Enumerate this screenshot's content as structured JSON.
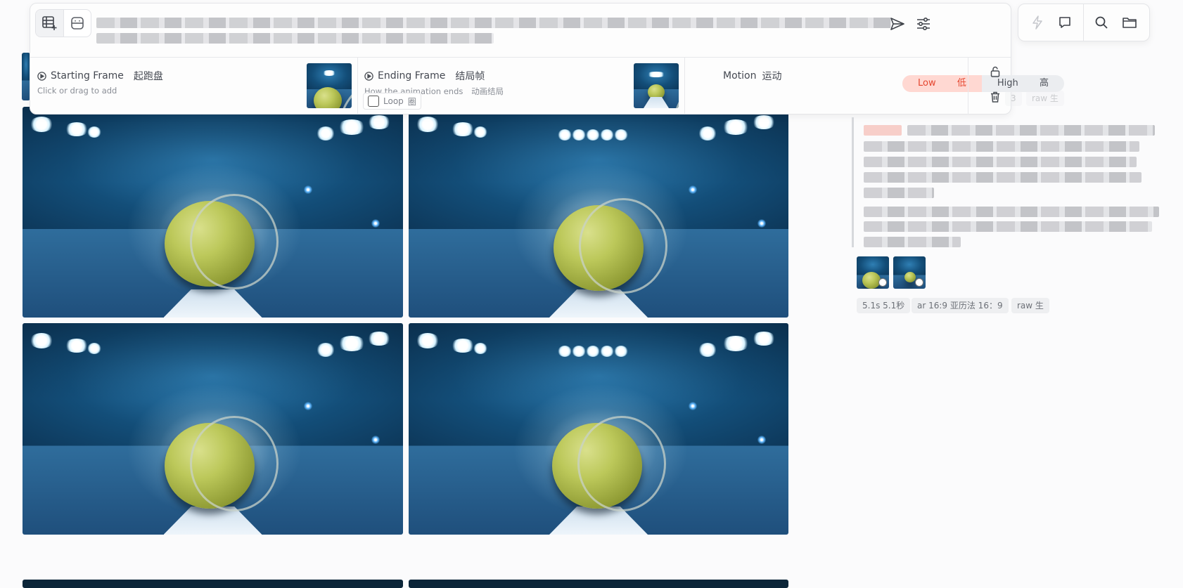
{
  "prompt_bar": {
    "mode_buttons": [
      {
        "icon": "image-add-icon"
      },
      {
        "icon": "portrait-icon"
      }
    ],
    "actions": [
      {
        "icon": "send-icon"
      },
      {
        "icon": "sliders-icon"
      }
    ],
    "starting_frame": {
      "label": "Starting Frame",
      "label_cn": "起跑盘",
      "hint": "Click or drag to add"
    },
    "ending_frame": {
      "label": "Ending Frame",
      "label_cn": "结局帧",
      "hint": "How the animation ends",
      "hint_cn": "动画结局",
      "loop_label": "Loop",
      "loop_label_cn": "圈"
    },
    "motion": {
      "label": "Motion",
      "label_cn": "运动",
      "options": [
        {
          "label": "Low",
          "label_cn": "低",
          "selected": true
        },
        {
          "label": "High",
          "label_cn": "高",
          "selected": false
        }
      ]
    },
    "side_icons": [
      "lock-open-icon",
      "trash-icon"
    ]
  },
  "toolbar": {
    "icons": [
      "lightning-icon",
      "chat-icon",
      "search-icon",
      "folder-icon"
    ]
  },
  "job": {
    "behind_tags": [
      "3",
      "raw 生"
    ],
    "tags": [
      "5.1s  5.1秒",
      "ar 16:9  亚历法 16：9",
      "raw  生"
    ]
  },
  "colors": {
    "accent_low_bg": "#ffd8d2",
    "accent_low_text": "#e5462f"
  }
}
